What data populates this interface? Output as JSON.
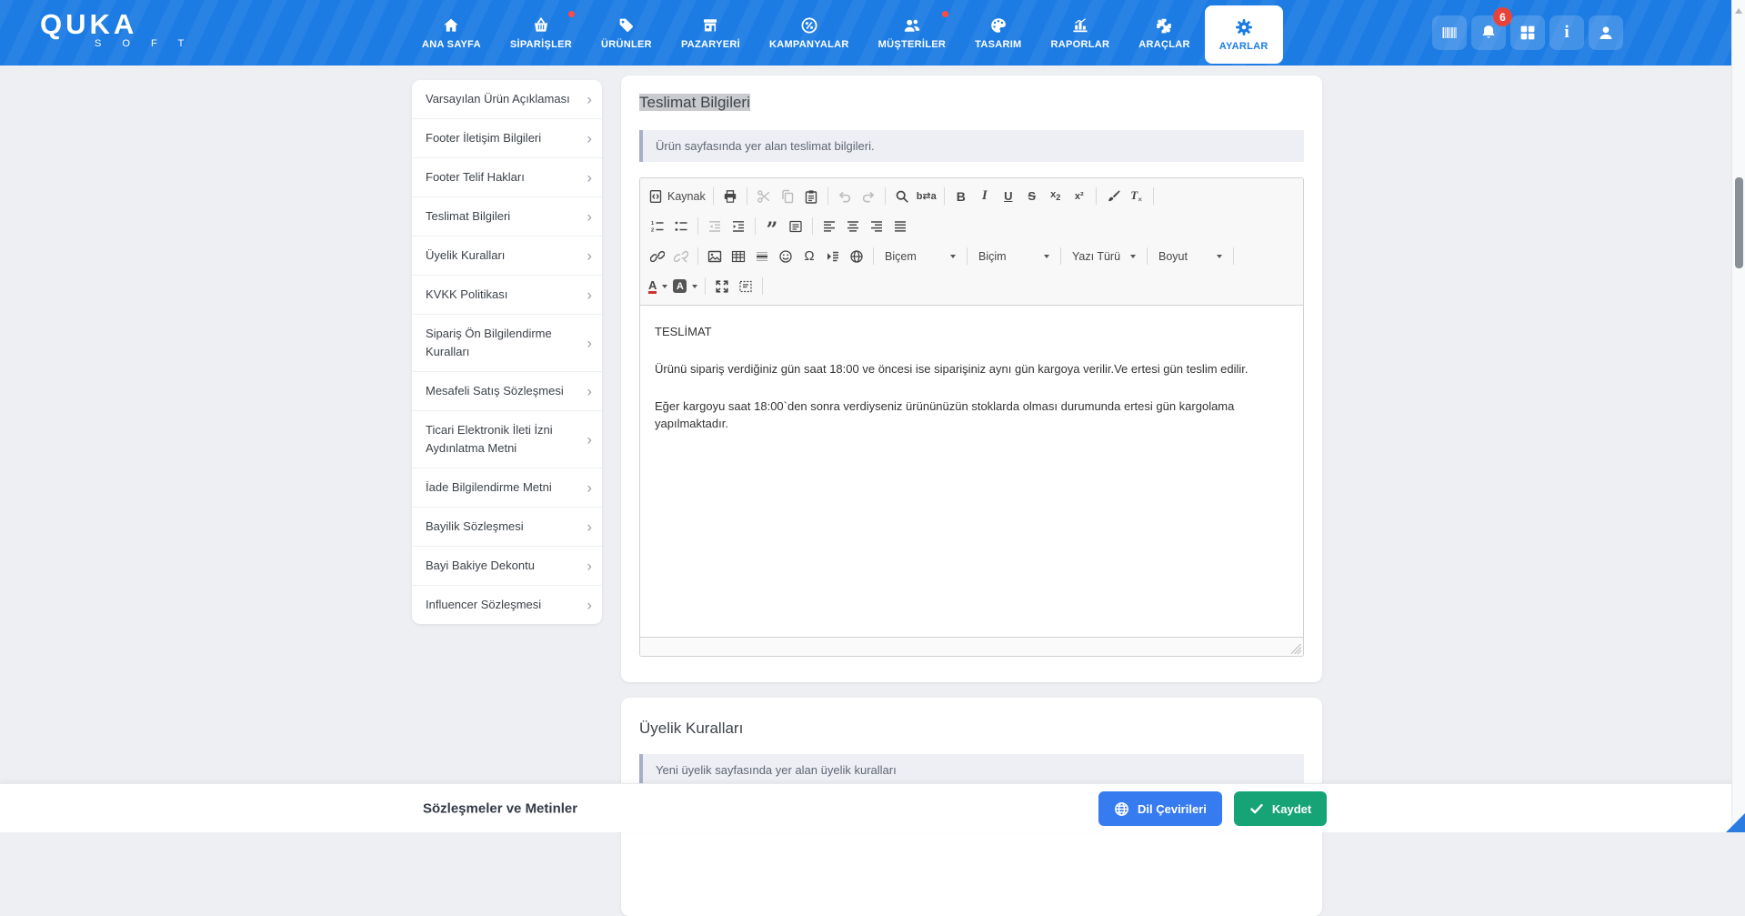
{
  "navbar": {
    "brand": {
      "title": "QUKA",
      "subtitle": "S O F T"
    },
    "items": [
      {
        "label": "ANA SAYFA",
        "icon": "home-icon",
        "active": false,
        "dot": false
      },
      {
        "label": "SİPARİŞLER",
        "icon": "basket-icon",
        "active": false,
        "dot": true
      },
      {
        "label": "ÜRÜNLER",
        "icon": "tag-icon",
        "active": false,
        "dot": false
      },
      {
        "label": "PAZARYERİ",
        "icon": "storefront-icon",
        "active": false,
        "dot": false
      },
      {
        "label": "KAMPANYALAR",
        "icon": "percent-icon",
        "active": false,
        "dot": false
      },
      {
        "label": "MÜŞTERİLER",
        "icon": "customers-icon",
        "active": false,
        "dot": true
      },
      {
        "label": "TASARIM",
        "icon": "palette-icon",
        "active": false,
        "dot": false
      },
      {
        "label": "RAPORLAR",
        "icon": "bar-chart-icon",
        "active": false,
        "dot": false
      },
      {
        "label": "ARAÇLAR",
        "icon": "puzzle-icon",
        "active": false,
        "dot": false
      },
      {
        "label": "AYARLAR",
        "icon": "gear-icon",
        "active": true,
        "dot": false
      }
    ],
    "quick_icons": [
      "barcode-icon",
      "bell-icon",
      "apps-grid-icon",
      "info-icon",
      "user-icon"
    ],
    "notification_count": "6"
  },
  "sidebar": {
    "items": [
      "Varsayılan Ürün Açıklaması",
      "Footer İletişim Bilgileri",
      "Footer Telif Hakları",
      "Teslimat Bilgileri",
      "Üyelik Kuralları",
      "KVKK Politikası",
      "Sipariş Ön Bilgilendirme Kuralları",
      "Mesafeli Satış Sözleşmesi",
      "Ticari Elektronik İleti İzni Aydınlatma Metni",
      "İade Bilgilendirme Metni",
      "Bayilik Sözleşmesi",
      "Bayi Bakiye Dekontu",
      "Influencer Sözleşmesi"
    ]
  },
  "page": {
    "sections": [
      {
        "title": "Teslimat Bilgileri",
        "note": "Ürün sayfasında yer alan teslimat bilgileri."
      },
      {
        "title": "Üyelik Kuralları",
        "note": "Yeni üyelik sayfasında yer alan üyelik kuralları"
      }
    ]
  },
  "editor": {
    "source_label": "Kaynak",
    "dropdowns": {
      "style": "Biçem",
      "format": "Biçim",
      "font": "Yazı Türü",
      "size": "Boyut"
    },
    "toolbar": {
      "row1": [
        "source",
        "print",
        "cut",
        "copy",
        "paste",
        "undo",
        "redo",
        "find",
        "replace",
        "bold",
        "italic",
        "underline",
        "strikethrough",
        "subscript",
        "superscript",
        "copy-formatting",
        "remove-format"
      ],
      "row2": [
        "numbered-list",
        "bulleted-list",
        "outdent",
        "indent",
        "blockquote",
        "div-container",
        "align-left",
        "align-center",
        "align-right",
        "justify"
      ],
      "row3": [
        "link",
        "unlink",
        "image",
        "table",
        "horizontal-rule",
        "smiley",
        "special-character",
        "page-break",
        "globe",
        "style-dropdown",
        "format-dropdown",
        "font-dropdown",
        "size-dropdown"
      ],
      "row4": [
        "text-color",
        "background-color",
        "maximize",
        "show-blocks"
      ],
      "disabled": [
        "cut",
        "copy",
        "undo",
        "redo",
        "outdent",
        "unlink"
      ]
    },
    "content": {
      "heading": "TESLİMAT",
      "paragraph1": "Ürünü sipariş verdiğiniz gün saat 18:00 ve öncesi ise siparişiniz aynı gün kargoya verilir.Ve ertesi gün teslim edilir.",
      "paragraph2": "Eğer kargoyu saat 18:00`den sonra verdiyseniz ürününüzün stoklarda olması durumunda ertesi gün kargolama yapılmaktadır."
    }
  },
  "footer": {
    "title": "Sözleşmeler ve Metinler",
    "buttons": [
      {
        "label": "Dil Çevirileri",
        "icon": "globe-icon"
      },
      {
        "label": "Kaydet",
        "icon": "check-icon"
      }
    ]
  },
  "colors": {
    "navbar_blue": "#1c7ce4",
    "badge_red": "#e6443a",
    "primary_button_blue": "#377bf0",
    "save_button_green": "#16a375",
    "note_bg": "#edeff4",
    "note_border": "#a9b0c6",
    "title_selection_highlight": "#c9cbce"
  }
}
